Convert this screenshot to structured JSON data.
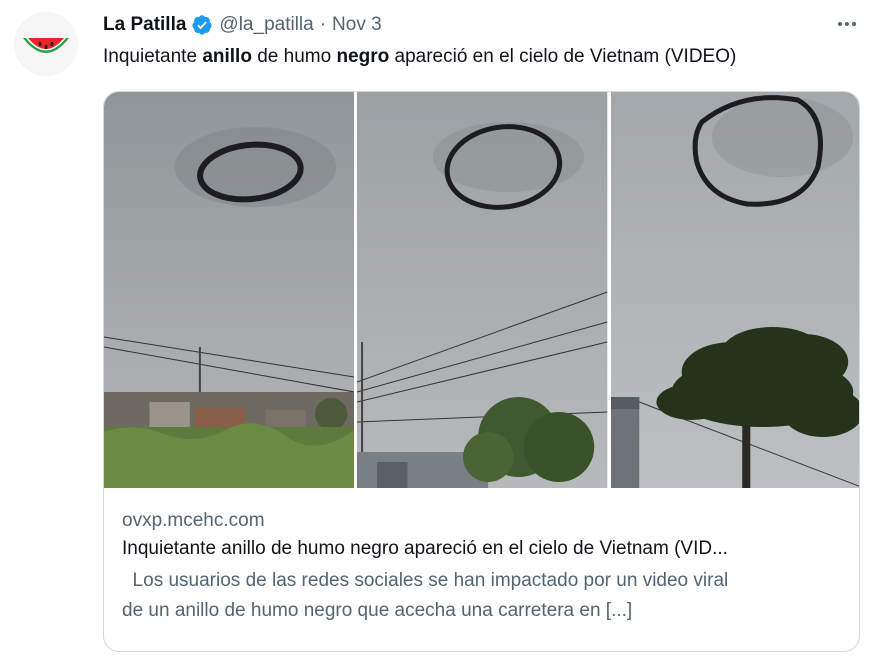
{
  "tweet": {
    "author_name": "La Patilla",
    "handle": "@la_patilla",
    "separator": "·",
    "date": "Nov 3",
    "text_parts": [
      "Inquietante ",
      "anillo",
      " de humo ",
      "negro",
      " apareció en el cielo de Vietnam (VIDEO)"
    ]
  },
  "card": {
    "domain": "ovxp.mcehc.com",
    "title": "Inquietante anillo de humo negro apareció en el cielo de Vietnam (VID...",
    "description_line1": "  Los usuarios de las redes sociales se han impactado por un video viral",
    "description_line2": "de un anillo de humo negro que acecha una carretera en [...]"
  },
  "icons": {
    "avatar": "watermelon-logo-icon",
    "verified": "verified-badge-icon",
    "more": "more-options-icon"
  },
  "colors": {
    "verified_blue": "#1d9bf0",
    "secondary_text": "#536471",
    "border": "#cfd9de"
  }
}
